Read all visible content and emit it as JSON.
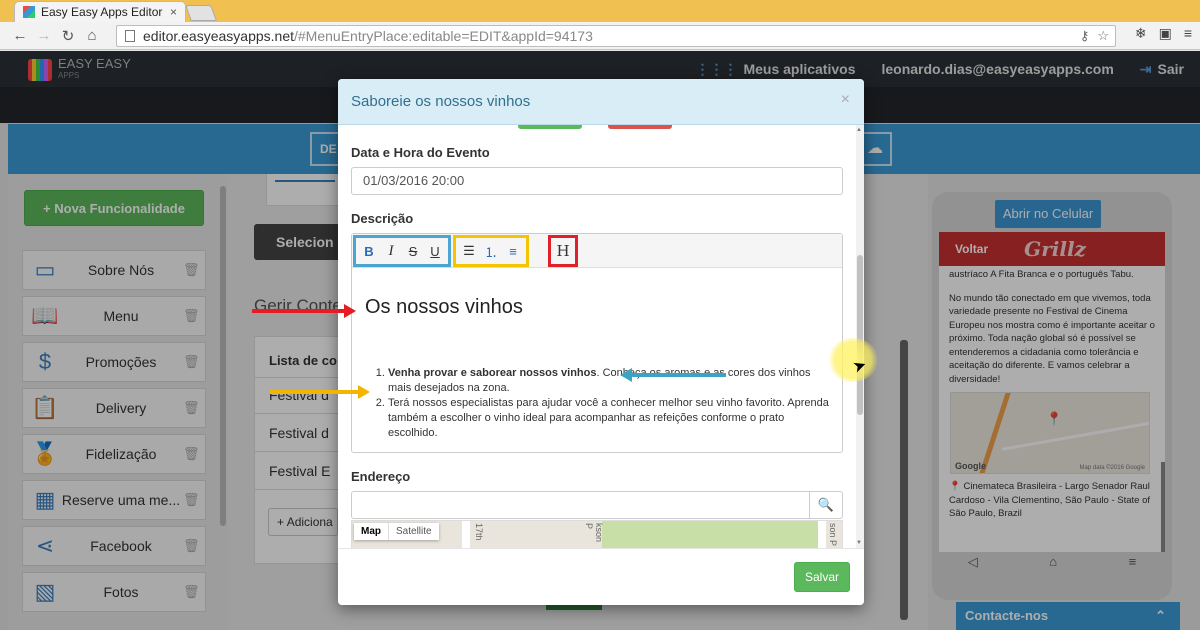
{
  "browser": {
    "tab_title": "Easy Easy Apps Editor",
    "url_host": "editor.easyeasyapps.net",
    "url_rest": "/#MenuEntryPlace:editable=EDIT&appId=94173"
  },
  "app": {
    "logo_text": "EASY EASY",
    "logo_sub": "APPS",
    "my_apps": "Meus aplicativos",
    "user_email": "leonardo.dias@easyeasyapps.com",
    "logout": "Sair",
    "de_label": "DE"
  },
  "sidebar": {
    "new_feature": "Nova Funcionalidade",
    "items": [
      {
        "label": "Sobre Nós"
      },
      {
        "label": "Menu"
      },
      {
        "label": "Promoções"
      },
      {
        "label": "Delivery"
      },
      {
        "label": "Fidelização"
      },
      {
        "label": "Reserve uma me..."
      },
      {
        "label": "Facebook"
      },
      {
        "label": "Fotos"
      }
    ]
  },
  "middle": {
    "select_button": "Selecion",
    "manage_title": "Gerir Conte",
    "list_header": "Lista de co",
    "rows": [
      "Festival d",
      "Festival d",
      "Festival E"
    ],
    "add_button": "Adiciona"
  },
  "phone": {
    "open_button": "Abrir no Celular",
    "back": "Voltar",
    "brand": "Grillz",
    "text_lines": [
      "austríaco A Fita Branca e o português Tabu.",
      "",
      "No mundo tão conectado em que vivemos, toda variedade presente no Festival de Cinema Europeu nos mostra como é importante aceitar o próximo. Toda nação global só é possível se entenderemos a cidadania como tolerância e aceitação do diferente. E vamos celebrar a diversidade!"
    ],
    "address": "Cinemateca Brasileira - Largo Senador Raul Cardoso - Vila Clementino, São Paulo - State of São Paulo, Brazil",
    "map_logo": "Google",
    "map_copy": "Map data ©2016 Google"
  },
  "contact": {
    "label": "Contacte-nos"
  },
  "modal": {
    "title": "Saboreie os nossos vinhos",
    "close": "×",
    "date_label": "Data e Hora do Evento",
    "date_value": "01/03/2016 20:00",
    "description_label": "Descrição",
    "editor_heading": "Os nossos vinhos",
    "item1_bold": "Venha provar e saborear nossos vinhos",
    "item1_rest": ". Conheça os aromas e as cores dos vinhos mais desejados na zona.",
    "item2": "Terá nossos especialistas para ajudar você a conhecer melhor seu vinho favorito. Aprenda também a escolher o vinho ideal para acompanhar as refeições conforme o prato escolhido.",
    "address_label": "Endereço",
    "address_value": "",
    "map_label": "Map",
    "satellite_label": "Satellite",
    "map_road_1": "17th",
    "map_road_2": "kson P",
    "map_road_3": "son P",
    "save": "Salvar"
  },
  "toolbar_buttons": {
    "bold": "B",
    "italic": "I",
    "strike": "S",
    "underline": "U",
    "heading": "H"
  },
  "annotation_colors": {
    "red": "#e51c23",
    "yellow": "#f5b400",
    "blue": "#3ba3c4"
  }
}
